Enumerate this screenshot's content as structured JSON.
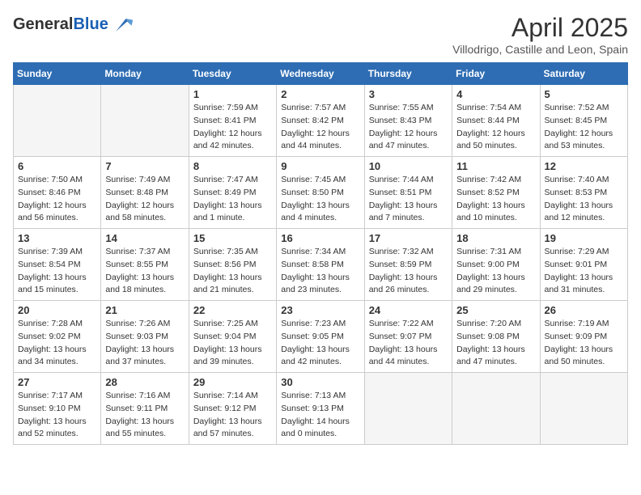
{
  "header": {
    "logo_line1": "General",
    "logo_line2": "Blue",
    "month_title": "April 2025",
    "location": "Villodrigo, Castille and Leon, Spain"
  },
  "days_of_week": [
    "Sunday",
    "Monday",
    "Tuesday",
    "Wednesday",
    "Thursday",
    "Friday",
    "Saturday"
  ],
  "weeks": [
    [
      {
        "day": "",
        "info": ""
      },
      {
        "day": "",
        "info": ""
      },
      {
        "day": "1",
        "info": "Sunrise: 7:59 AM\nSunset: 8:41 PM\nDaylight: 12 hours and 42 minutes."
      },
      {
        "day": "2",
        "info": "Sunrise: 7:57 AM\nSunset: 8:42 PM\nDaylight: 12 hours and 44 minutes."
      },
      {
        "day": "3",
        "info": "Sunrise: 7:55 AM\nSunset: 8:43 PM\nDaylight: 12 hours and 47 minutes."
      },
      {
        "day": "4",
        "info": "Sunrise: 7:54 AM\nSunset: 8:44 PM\nDaylight: 12 hours and 50 minutes."
      },
      {
        "day": "5",
        "info": "Sunrise: 7:52 AM\nSunset: 8:45 PM\nDaylight: 12 hours and 53 minutes."
      }
    ],
    [
      {
        "day": "6",
        "info": "Sunrise: 7:50 AM\nSunset: 8:46 PM\nDaylight: 12 hours and 56 minutes."
      },
      {
        "day": "7",
        "info": "Sunrise: 7:49 AM\nSunset: 8:48 PM\nDaylight: 12 hours and 58 minutes."
      },
      {
        "day": "8",
        "info": "Sunrise: 7:47 AM\nSunset: 8:49 PM\nDaylight: 13 hours and 1 minute."
      },
      {
        "day": "9",
        "info": "Sunrise: 7:45 AM\nSunset: 8:50 PM\nDaylight: 13 hours and 4 minutes."
      },
      {
        "day": "10",
        "info": "Sunrise: 7:44 AM\nSunset: 8:51 PM\nDaylight: 13 hours and 7 minutes."
      },
      {
        "day": "11",
        "info": "Sunrise: 7:42 AM\nSunset: 8:52 PM\nDaylight: 13 hours and 10 minutes."
      },
      {
        "day": "12",
        "info": "Sunrise: 7:40 AM\nSunset: 8:53 PM\nDaylight: 13 hours and 12 minutes."
      }
    ],
    [
      {
        "day": "13",
        "info": "Sunrise: 7:39 AM\nSunset: 8:54 PM\nDaylight: 13 hours and 15 minutes."
      },
      {
        "day": "14",
        "info": "Sunrise: 7:37 AM\nSunset: 8:55 PM\nDaylight: 13 hours and 18 minutes."
      },
      {
        "day": "15",
        "info": "Sunrise: 7:35 AM\nSunset: 8:56 PM\nDaylight: 13 hours and 21 minutes."
      },
      {
        "day": "16",
        "info": "Sunrise: 7:34 AM\nSunset: 8:58 PM\nDaylight: 13 hours and 23 minutes."
      },
      {
        "day": "17",
        "info": "Sunrise: 7:32 AM\nSunset: 8:59 PM\nDaylight: 13 hours and 26 minutes."
      },
      {
        "day": "18",
        "info": "Sunrise: 7:31 AM\nSunset: 9:00 PM\nDaylight: 13 hours and 29 minutes."
      },
      {
        "day": "19",
        "info": "Sunrise: 7:29 AM\nSunset: 9:01 PM\nDaylight: 13 hours and 31 minutes."
      }
    ],
    [
      {
        "day": "20",
        "info": "Sunrise: 7:28 AM\nSunset: 9:02 PM\nDaylight: 13 hours and 34 minutes."
      },
      {
        "day": "21",
        "info": "Sunrise: 7:26 AM\nSunset: 9:03 PM\nDaylight: 13 hours and 37 minutes."
      },
      {
        "day": "22",
        "info": "Sunrise: 7:25 AM\nSunset: 9:04 PM\nDaylight: 13 hours and 39 minutes."
      },
      {
        "day": "23",
        "info": "Sunrise: 7:23 AM\nSunset: 9:05 PM\nDaylight: 13 hours and 42 minutes."
      },
      {
        "day": "24",
        "info": "Sunrise: 7:22 AM\nSunset: 9:07 PM\nDaylight: 13 hours and 44 minutes."
      },
      {
        "day": "25",
        "info": "Sunrise: 7:20 AM\nSunset: 9:08 PM\nDaylight: 13 hours and 47 minutes."
      },
      {
        "day": "26",
        "info": "Sunrise: 7:19 AM\nSunset: 9:09 PM\nDaylight: 13 hours and 50 minutes."
      }
    ],
    [
      {
        "day": "27",
        "info": "Sunrise: 7:17 AM\nSunset: 9:10 PM\nDaylight: 13 hours and 52 minutes."
      },
      {
        "day": "28",
        "info": "Sunrise: 7:16 AM\nSunset: 9:11 PM\nDaylight: 13 hours and 55 minutes."
      },
      {
        "day": "29",
        "info": "Sunrise: 7:14 AM\nSunset: 9:12 PM\nDaylight: 13 hours and 57 minutes."
      },
      {
        "day": "30",
        "info": "Sunrise: 7:13 AM\nSunset: 9:13 PM\nDaylight: 14 hours and 0 minutes."
      },
      {
        "day": "",
        "info": ""
      },
      {
        "day": "",
        "info": ""
      },
      {
        "day": "",
        "info": ""
      }
    ]
  ]
}
